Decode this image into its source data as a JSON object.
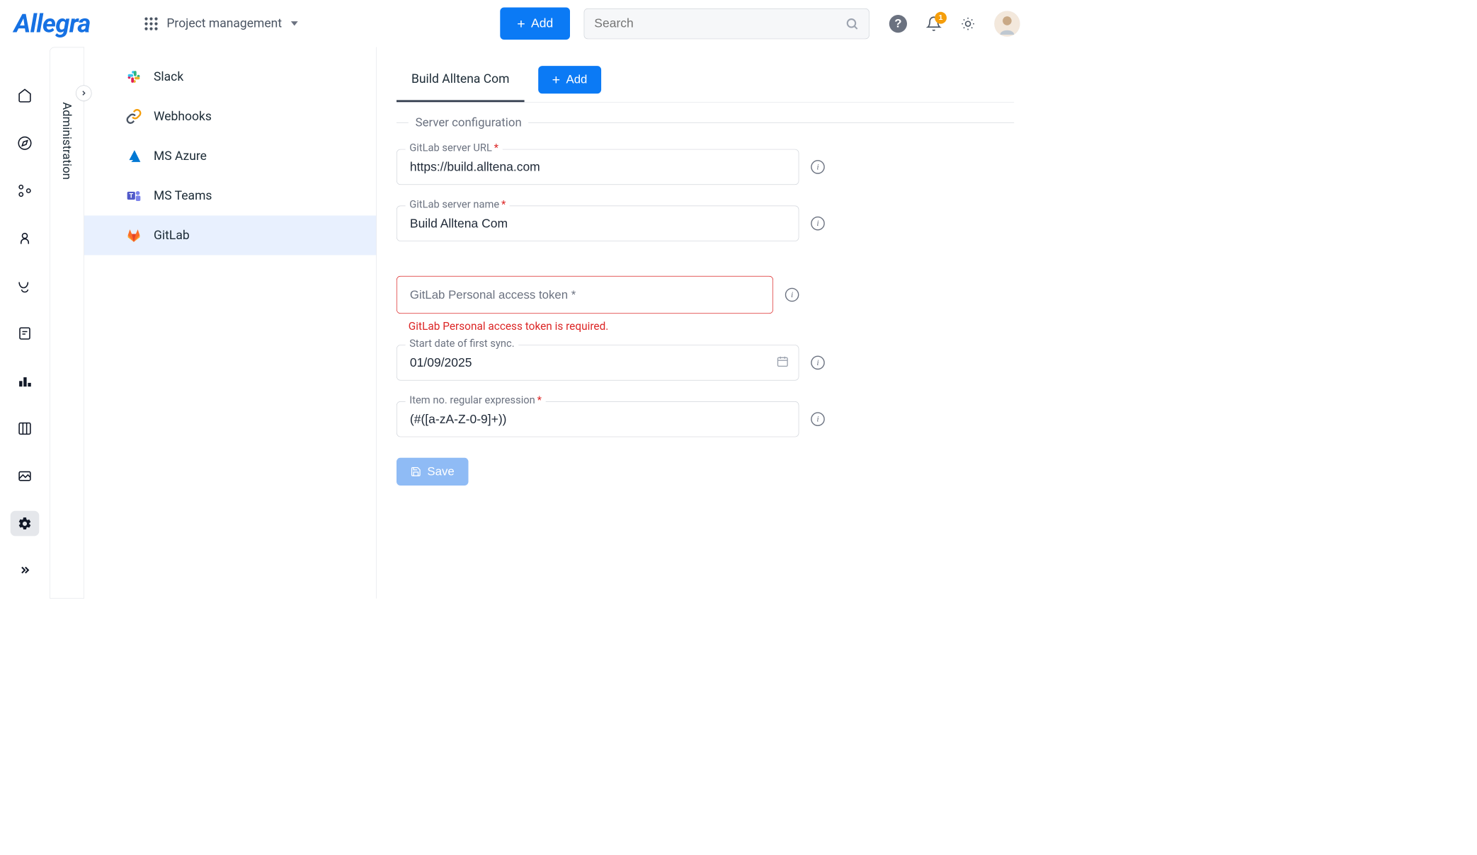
{
  "logo": "Allegra",
  "module": {
    "label": "Project management"
  },
  "topbar": {
    "add_label": "Add",
    "search_placeholder": "Search",
    "notification_count": "1"
  },
  "admin": {
    "label": "Administration"
  },
  "sidebar": {
    "items": [
      {
        "label": "Slack",
        "icon": "slack"
      },
      {
        "label": "Webhooks",
        "icon": "webhook"
      },
      {
        "label": "MS Azure",
        "icon": "azure"
      },
      {
        "label": "MS Teams",
        "icon": "msteams"
      },
      {
        "label": "GitLab",
        "icon": "gitlab",
        "active": true
      }
    ]
  },
  "content": {
    "tabs": [
      {
        "label": "Build Alltena Com",
        "active": true
      }
    ],
    "add_tab_label": "Add",
    "section_title": "Server configuration",
    "fields": {
      "server_url": {
        "label": "GitLab server URL",
        "value": "https://build.alltena.com",
        "required": true
      },
      "server_name": {
        "label": "GitLab server name",
        "value": "Build Alltena Com",
        "required": true
      },
      "token": {
        "label": "GitLab Personal access token",
        "value": "",
        "required": true,
        "error": "GitLab Personal access token is required."
      },
      "start_date": {
        "label": "Start date of first sync.",
        "value": "01/09/2025",
        "required": false
      },
      "regex": {
        "label": "Item no. regular expression",
        "value": "(#([a-zA-Z-0-9]+))",
        "required": true
      }
    },
    "save_label": "Save"
  }
}
